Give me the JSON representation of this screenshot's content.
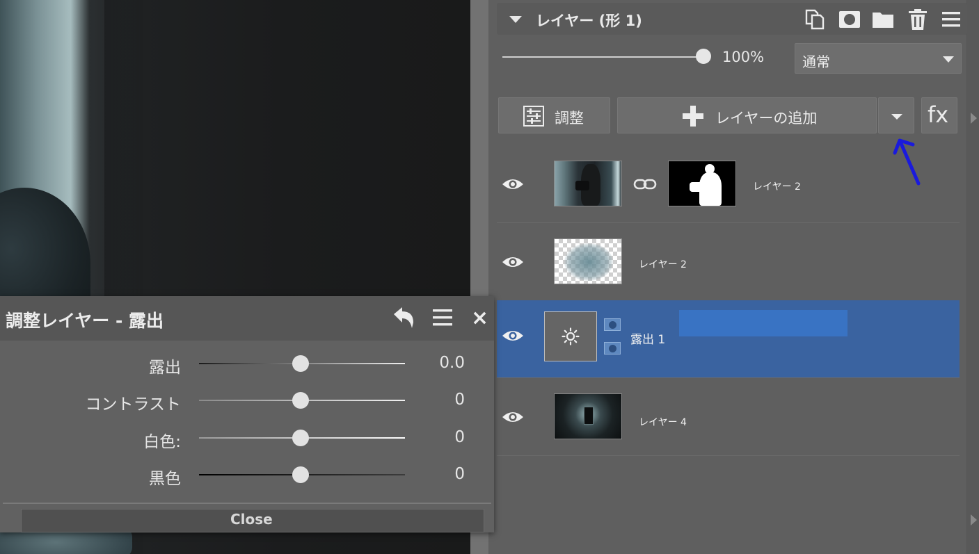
{
  "layers_panel": {
    "title": "レイヤー (形 1)",
    "opacity": {
      "value": 100,
      "label": "100%"
    },
    "blend_mode": "通常",
    "buttons": {
      "adjust": "調整",
      "add_layer": "レイヤーの追加",
      "fx": "fx"
    },
    "layers": [
      {
        "name": "レイヤー 2",
        "thumb": "photo-with-mask",
        "selected": false
      },
      {
        "name": "レイヤー 2",
        "thumb": "transparent-blur",
        "selected": false
      },
      {
        "name": "露出 1",
        "thumb": "adjustment-exposure",
        "selected": true
      },
      {
        "name": "レイヤー 4",
        "thumb": "hallway-photo",
        "selected": false
      }
    ]
  },
  "adjust_dialog": {
    "title": "調整レイヤー - 露出",
    "rows": [
      {
        "label": "露出",
        "value": "0.0"
      },
      {
        "label": "コントラスト",
        "value": "0"
      },
      {
        "label": "白色:",
        "value": "0"
      },
      {
        "label": "黒色",
        "value": "0"
      }
    ],
    "close_label": "Close"
  },
  "colors": {
    "panel_bg": "#5f5f5f",
    "selected_layer": "#3a63a0",
    "annotation_arrow": "#1a1adc"
  },
  "icons": [
    "duplicate-icon",
    "mask-icon",
    "folder-icon",
    "trash-icon",
    "menu-icon",
    "adjust-sliders-icon",
    "plus-icon",
    "eye-icon",
    "link-icon",
    "sun-icon",
    "undo-icon",
    "close-icon"
  ]
}
